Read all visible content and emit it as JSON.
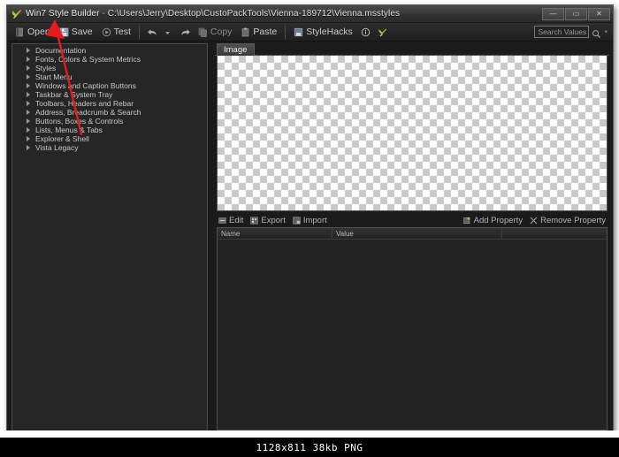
{
  "window": {
    "title_app": "Win7 Style Builder",
    "title_dash": "-",
    "title_path": "C:\\Users\\Jerry\\Desktop\\CustoPackTools\\Vienna-189712\\Vienna.msstyles",
    "app_icon": "style-builder-icon",
    "controls": {
      "minimize": "—",
      "maximize": "▭",
      "close": "✕"
    }
  },
  "toolbar": {
    "open_label": "Open",
    "save_label": "Save",
    "test_label": "Test",
    "undo_label": "",
    "undo_dropdown_label": "",
    "redo_label": "",
    "copy_label": "Copy",
    "paste_label": "Paste",
    "stylehacks_label": "StyleHacks",
    "info_label": "",
    "extra_label": ""
  },
  "search": {
    "placeholder": "Search Values",
    "value": "",
    "icon": "search-icon",
    "chevron": "▾"
  },
  "tree": {
    "items": [
      {
        "label": "Documentation"
      },
      {
        "label": "Fonts, Colors & System Metrics"
      },
      {
        "label": "Styles"
      },
      {
        "label": "Start Menu"
      },
      {
        "label": "Windows and Caption Buttons"
      },
      {
        "label": "Taskbar & System Tray"
      },
      {
        "label": "Toolbars, Headers and Rebar"
      },
      {
        "label": "Address, Breadcrumb & Search"
      },
      {
        "label": "Buttons, Boxes & Controls"
      },
      {
        "label": "Lists, Menus & Tabs"
      },
      {
        "label": "Explorer & Shell"
      },
      {
        "label": "Vista Legacy"
      }
    ]
  },
  "right_panel": {
    "tabs": [
      {
        "label": "Image",
        "selected": true
      }
    ],
    "canvas": {
      "content": "",
      "background": "transparent-checkerboard"
    },
    "property_toolbar": {
      "edit_label": "Edit",
      "export_label": "Export",
      "import_label": "Import",
      "add_property_label": "Add Property",
      "remove_property_label": "Remove Property"
    },
    "property_table": {
      "columns": [
        "Name",
        "Value",
        ""
      ],
      "rows": []
    }
  },
  "annotation": {
    "arrow_color": "#e51c1c",
    "target": "save-button"
  },
  "footer": {
    "info": "1128x811 38kb PNG"
  },
  "colors": {
    "window_bg": "#1c1c1c",
    "panel_bg": "#262626",
    "panel_border": "#4e4e4e",
    "text": "#c9c9c9",
    "title_text": "#e8e8e8",
    "accent_red": "#e51c1c"
  }
}
